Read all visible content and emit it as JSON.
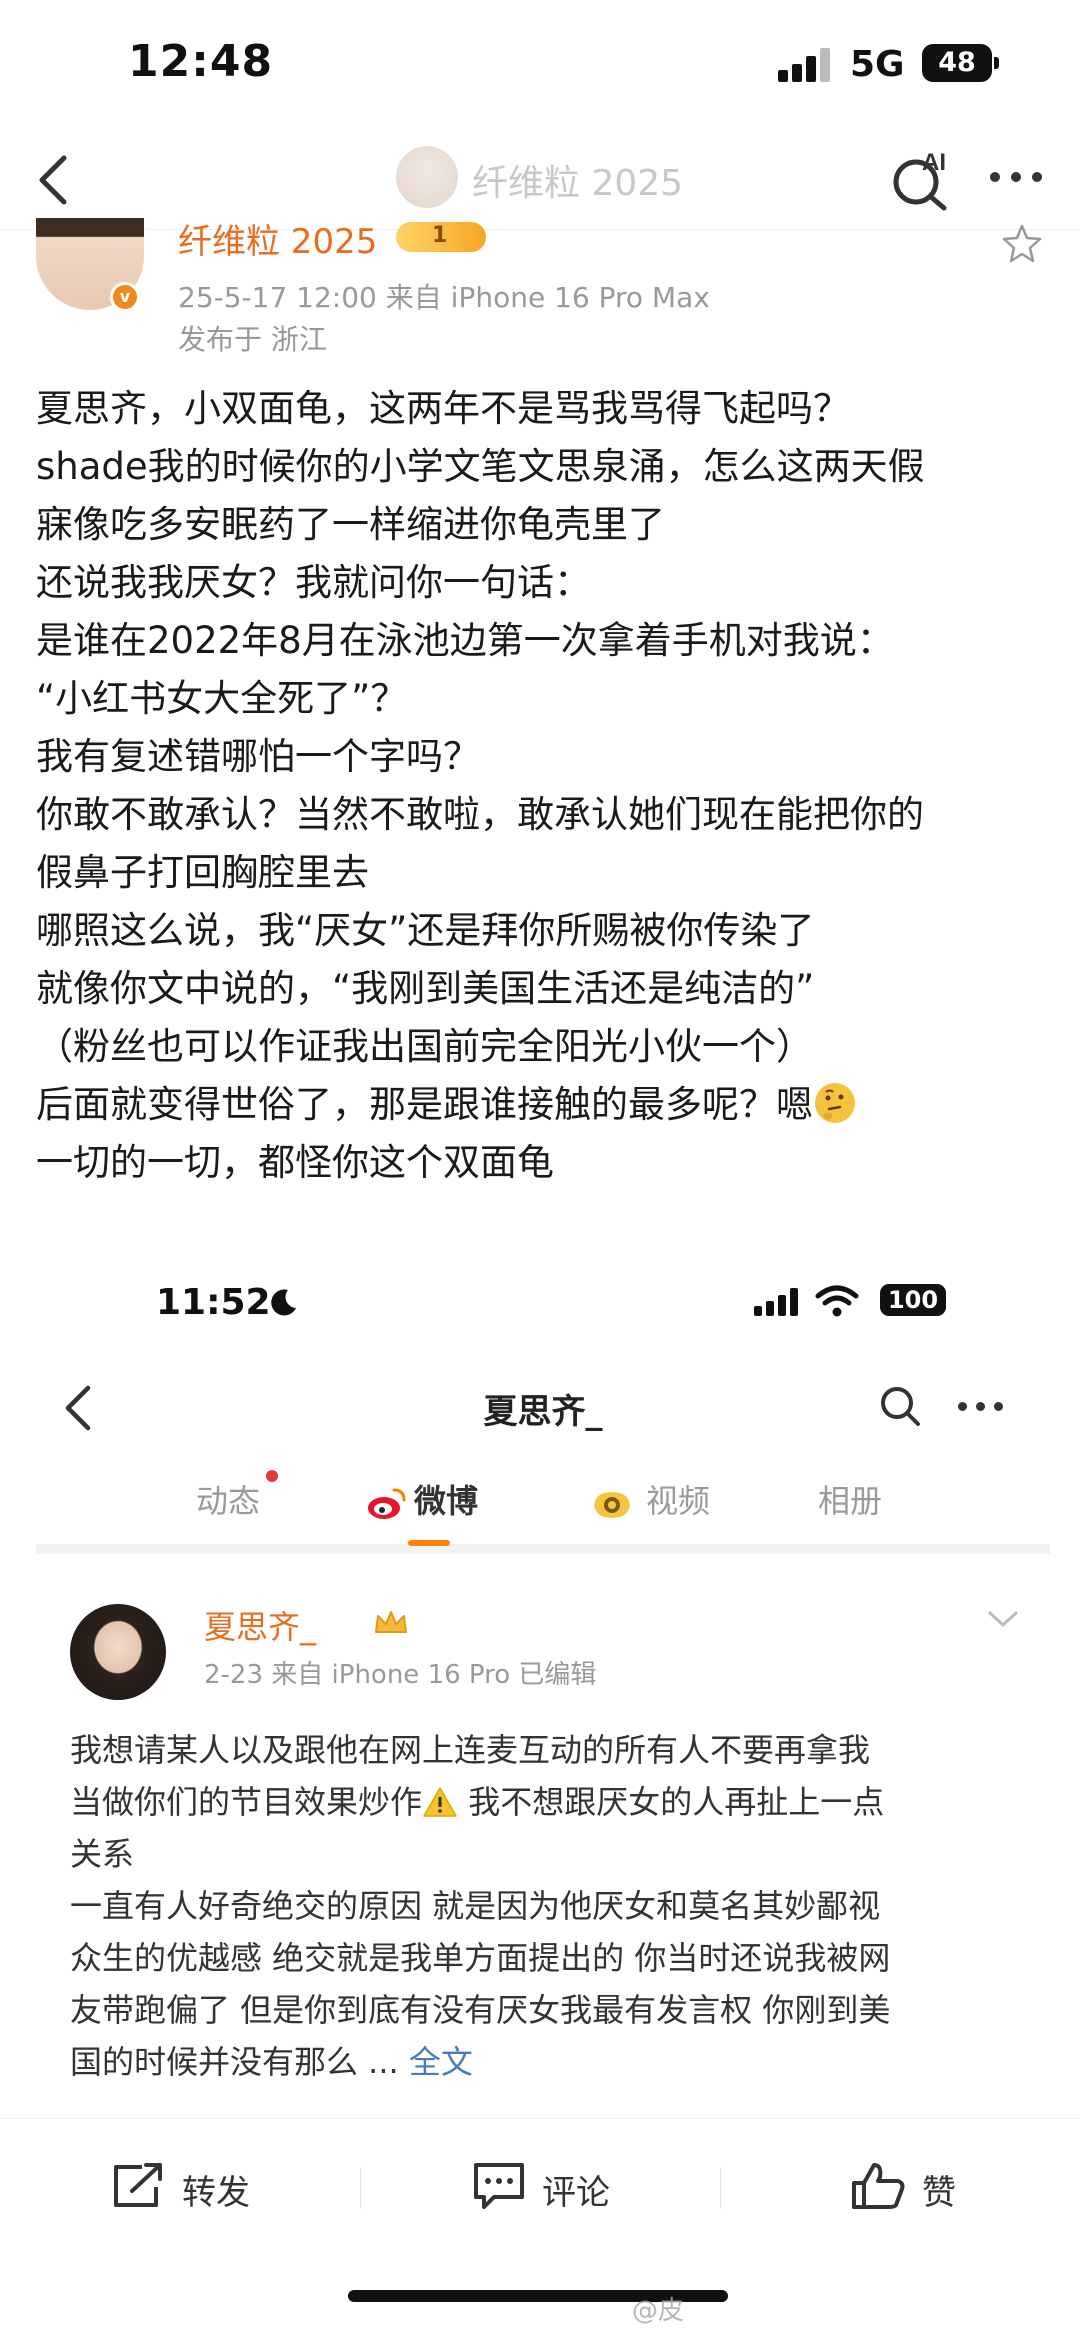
{
  "status_bar": {
    "time": "12:48",
    "network": "5G",
    "battery": "48"
  },
  "nav": {
    "title": "纤维粒 2025",
    "ai_label": "AI"
  },
  "post": {
    "author": "纤维粒 2025",
    "vip_level": "1",
    "meta": "25-5-17 12:00  来自 iPhone 16 Pro Max",
    "location": "发布于 浙江",
    "lines": [
      "夏思齐，小双面龟，这两年不是骂我骂得飞起吗？",
      "shade我的时候你的小学文笔文思泉涌，怎么这两天假",
      "寐像吃多安眠药了一样缩进你龟壳里了",
      "还说我我厌女？我就问你一句话：",
      "是谁在2022年8月在泳池边第一次拿着手机对我说：",
      "“小红书女大全死了”？",
      "我有复述错哪怕一个字吗？",
      "你敢不敢承认？当然不敢啦，敢承认她们现在能把你的",
      "假鼻子打回胸腔里去",
      "哪照这么说，我“厌女”还是拜你所赐被你传染了",
      "就像你文中说的，“我刚到美国生活还是纯洁的”",
      "（粉丝也可以作证我出国前完全阳光小伙一个）",
      "后面就变得世俗了，那是跟谁接触的最多呢？嗯",
      "一切的一切，都怪你这个双面龟"
    ]
  },
  "embedded": {
    "status_time": "11:52",
    "battery": "100",
    "title": "夏思齐_",
    "tabs": [
      "动态",
      "微博",
      "视频",
      "相册"
    ],
    "author": "夏思齐_",
    "meta": "2-23  来自 iPhone 16 Pro  已编辑",
    "lines": [
      "我想请某人以及跟他在网上连麦互动的所有人不要再拿我",
      "当做你们的节目效果炒作",
      "我不想跟厌女的人再扯上一点",
      "关系",
      "一直有人好奇绝交的原因 就是因为他厌女和莫名其妙鄙视",
      "众生的优越感 绝交就是我单方面提出的 你当时还说我被网",
      "友带跑偏了 但是你到底有没有厌女我最有发言权 你刚到美",
      "国的时候并没有那么 ..."
    ],
    "more_link": "全文"
  },
  "actions": {
    "repost": "转发",
    "comment": "评论",
    "like": "赞"
  },
  "watermark": "@皮",
  "colors": {
    "accent": "#ff8200",
    "author": "#e86d1f",
    "link": "#4a7bb5"
  }
}
